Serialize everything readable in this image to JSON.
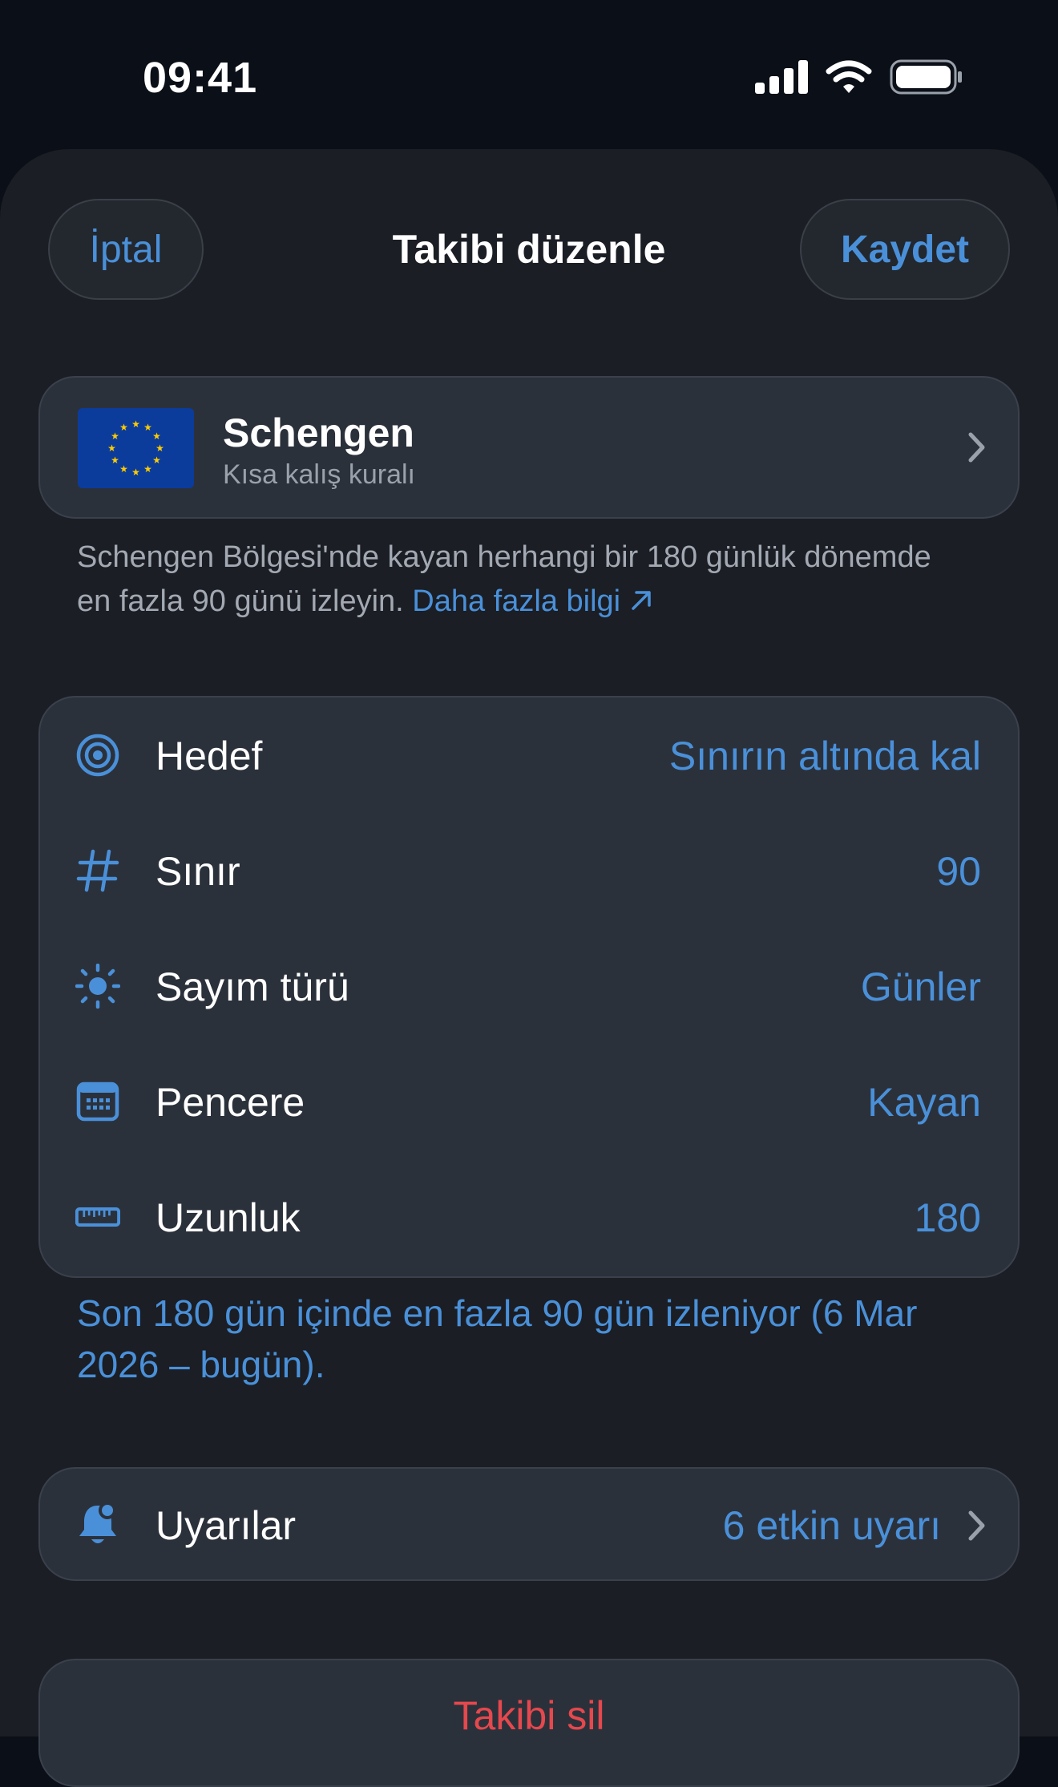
{
  "status": {
    "time": "09:41"
  },
  "nav": {
    "cancel": "İptal",
    "title": "Takibi düzenle",
    "save": "Kaydet"
  },
  "region": {
    "name": "Schengen",
    "subtitle": "Kısa kalış kuralı"
  },
  "description": {
    "text": "Schengen Bölgesi'nde kayan herhangi bir 180 günlük dönemde en fazla 90 günü izleyin. ",
    "link": "Daha fazla bilgi"
  },
  "settings": [
    {
      "icon": "target-icon",
      "label": "Hedef",
      "value": "Sınırın altında kal"
    },
    {
      "icon": "hash-icon",
      "label": "Sınır",
      "value": "90"
    },
    {
      "icon": "sun-icon",
      "label": "Sayım türü",
      "value": "Günler"
    },
    {
      "icon": "calendar-icon",
      "label": "Pencere",
      "value": "Kayan"
    },
    {
      "icon": "ruler-icon",
      "label": "Uzunluk",
      "value": "180"
    }
  ],
  "summary": "Son 180 gün içinde en fazla 90 gün izleniyor (6 Mar 2026 – bugün).",
  "alerts": {
    "icon": "bell-icon",
    "label": "Uyarılar",
    "value": "6 etkin uyarı"
  },
  "delete": {
    "label": "Takibi sil"
  },
  "colors": {
    "accent": "#4a90d9",
    "danger": "#e5484d",
    "card": "#2b313b",
    "background": "#1b1e24"
  }
}
